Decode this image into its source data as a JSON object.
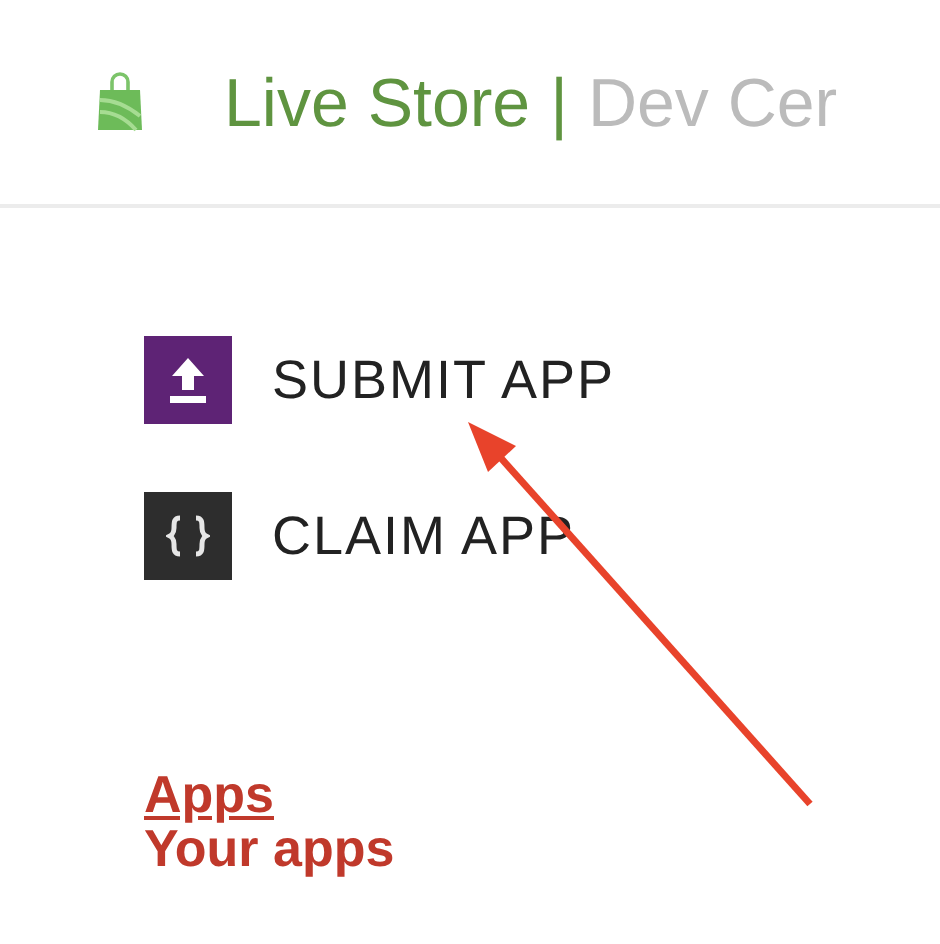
{
  "header": {
    "brand": "Live Store",
    "separator": "|",
    "subtitle": "Dev Cer"
  },
  "actions": [
    {
      "kind": "submit",
      "label": "SUBMIT APP"
    },
    {
      "kind": "claim",
      "label": "CLAIM APP"
    }
  ],
  "links": [
    {
      "label": "Apps",
      "selected": true
    },
    {
      "label": "Your apps",
      "selected": false
    }
  ]
}
